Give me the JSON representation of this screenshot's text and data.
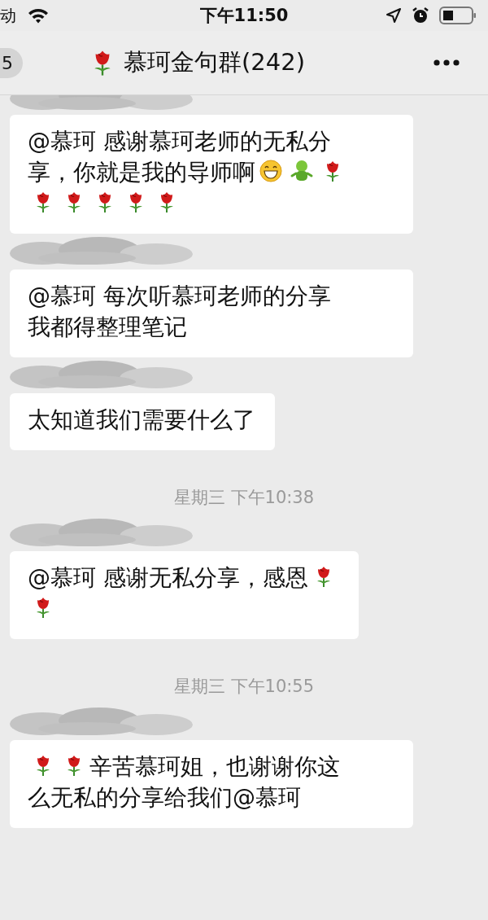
{
  "status_bar": {
    "carrier": "动",
    "time": "下午11:50"
  },
  "nav_bar": {
    "back_badge": "5",
    "title": "慕珂金句群(242)"
  },
  "messages": [
    {
      "kind": "message",
      "parts": [
        {
          "kind": "text",
          "text": "@慕珂 感谢慕珂老师的无私分"
        },
        {
          "kind": "text",
          "text": "享，你就是我的导师啊"
        },
        {
          "kind": "grin"
        },
        {
          "kind": "figure"
        },
        {
          "kind": "rose"
        },
        {
          "kind": "line_break"
        },
        {
          "kind": "rose"
        },
        {
          "kind": "rose"
        },
        {
          "kind": "rose"
        },
        {
          "kind": "rose"
        },
        {
          "kind": "rose"
        }
      ]
    },
    {
      "kind": "message",
      "parts": [
        {
          "kind": "text",
          "text": "@慕珂 每次听慕珂老师的分享"
        },
        {
          "kind": "text",
          "text": "我都得整理笔记"
        }
      ]
    },
    {
      "kind": "message",
      "parts": [
        {
          "kind": "text",
          "text": "太知道我们需要什么了"
        }
      ]
    },
    {
      "kind": "time",
      "text": "星期三 下午10:38"
    },
    {
      "kind": "message",
      "parts": [
        {
          "kind": "text",
          "text": "@慕珂 感谢无私分享，感恩"
        },
        {
          "kind": "rose"
        },
        {
          "kind": "line_break"
        },
        {
          "kind": "rose"
        }
      ]
    },
    {
      "kind": "time",
      "text": "星期三 下午10:55"
    },
    {
      "kind": "message",
      "parts": [
        {
          "kind": "rose"
        },
        {
          "kind": "rose"
        },
        {
          "kind": "text",
          "text": "辛苦慕珂姐，也谢谢你这"
        },
        {
          "kind": "text",
          "text": "么无私的分享给我们@慕珂"
        }
      ]
    }
  ]
}
